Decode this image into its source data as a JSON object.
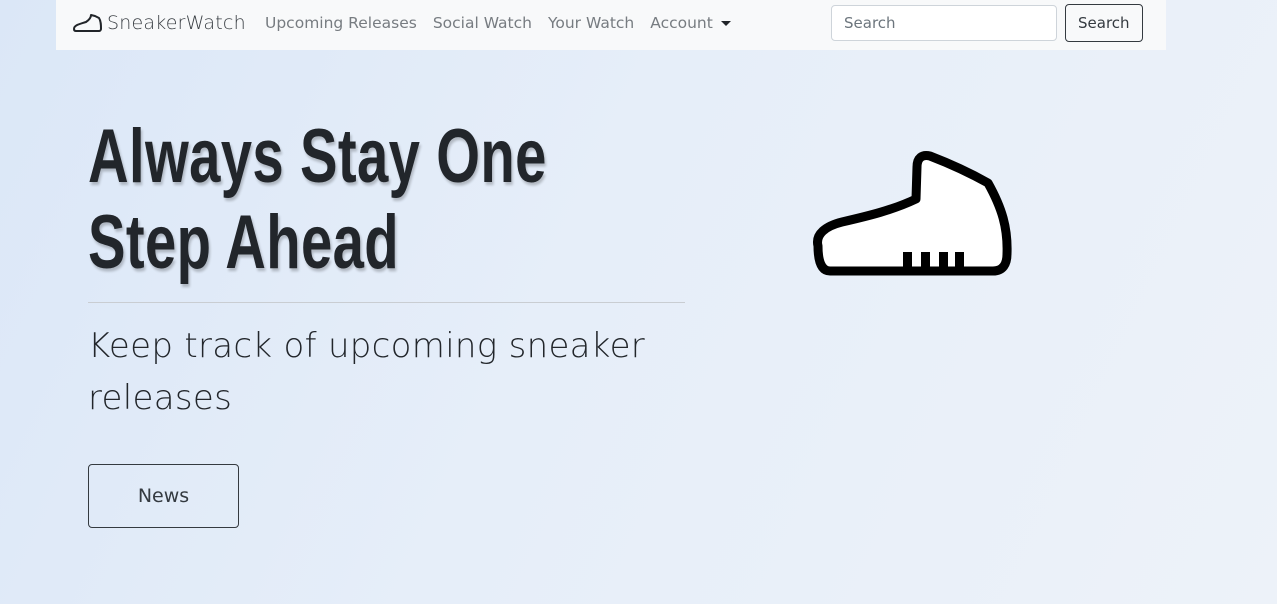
{
  "navbar": {
    "brand_name": "SneakerWatch",
    "brand_icon": "sneaker-icon",
    "links": [
      {
        "label": "Upcoming Releases"
      },
      {
        "label": "Social Watch"
      },
      {
        "label": "Your Watch"
      }
    ],
    "account": {
      "label": "Account",
      "icon": "caret-down-icon"
    },
    "search": {
      "placeholder": "Search",
      "value": "",
      "button_label": "Search"
    }
  },
  "hero": {
    "title_line1": "Always Stay One",
    "title_line2": "Step Ahead",
    "subtitle": "Keep track of upcoming sneaker releases",
    "news_button": "News",
    "illustration_icon": "sneaker-icon"
  },
  "colors": {
    "background": "#e3ecf8",
    "navbar": "#f8f9fa",
    "text_dark": "#212529",
    "nav_link": "#777c81"
  }
}
